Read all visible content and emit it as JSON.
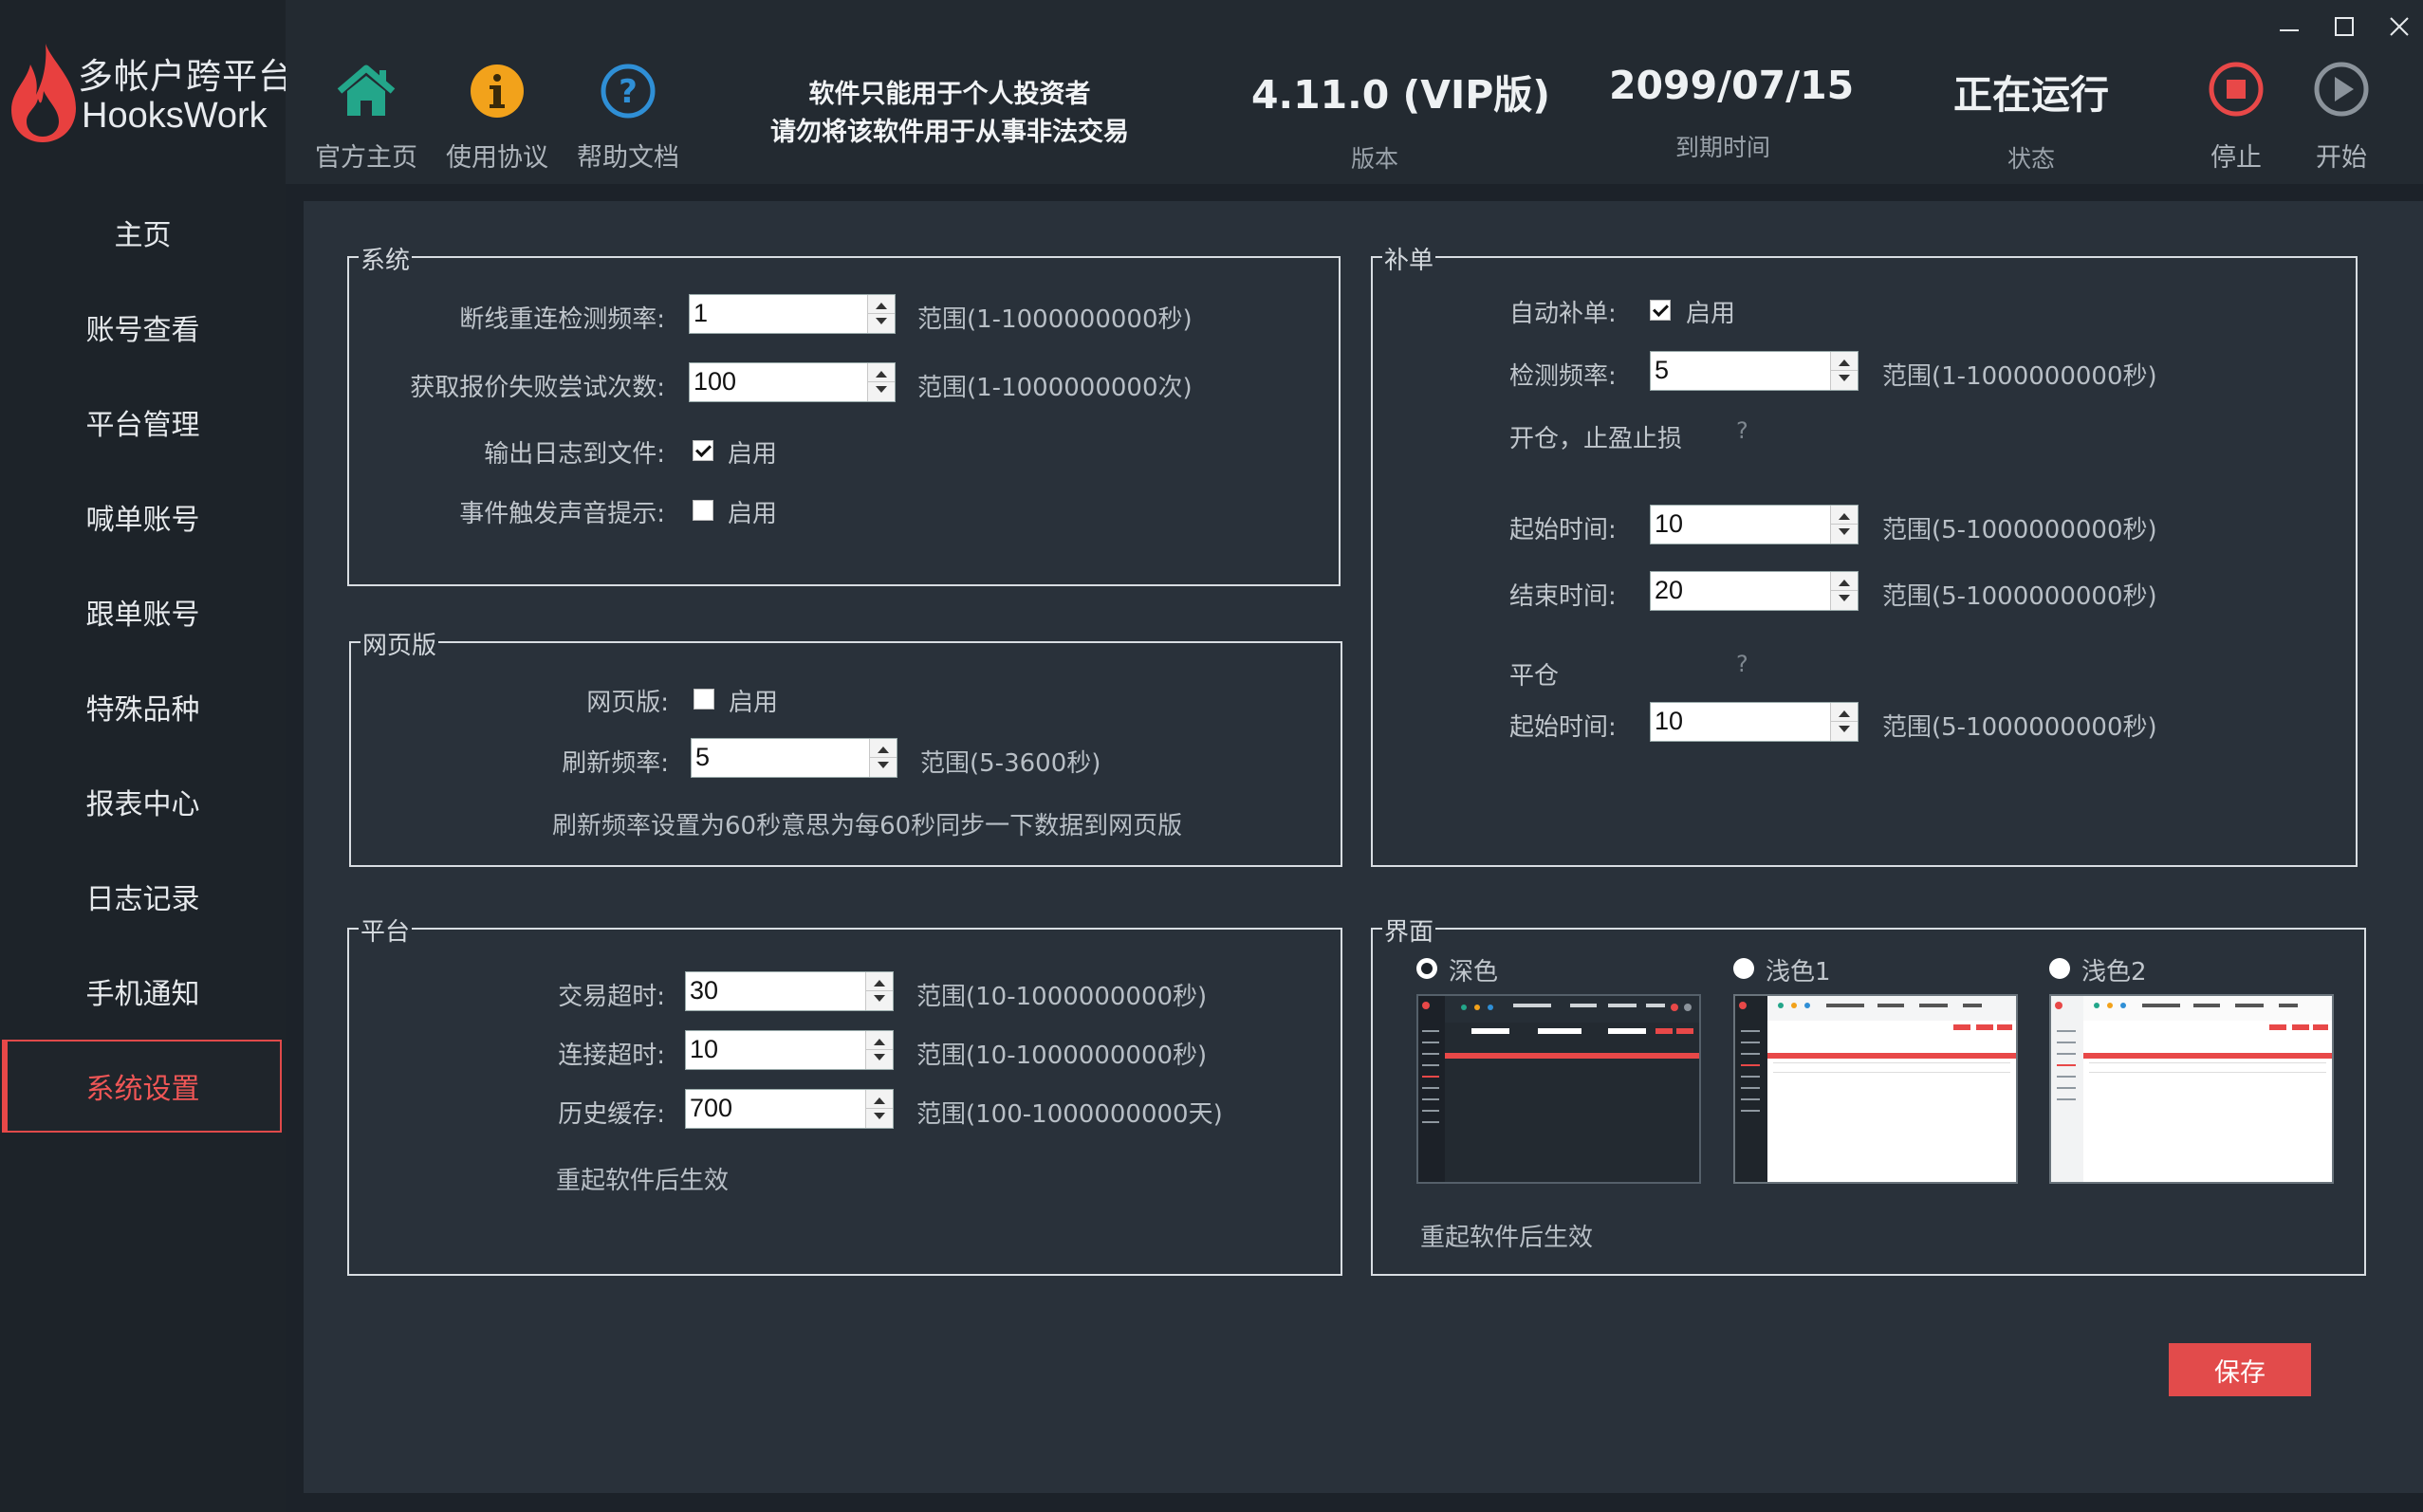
{
  "brand": {
    "title_cn": "多帐户跨平台",
    "title_en": "HooksWork"
  },
  "header": {
    "buttons": [
      {
        "label": "官方主页",
        "icon": "home-icon"
      },
      {
        "label": "使用协议",
        "icon": "info-icon"
      },
      {
        "label": "帮助文档",
        "icon": "help-icon"
      }
    ],
    "notice_line1": "软件只能用于个人投资者",
    "notice_line2": "请勿将该软件用于从事非法交易",
    "version_value": "4.11.0 (VIP版)",
    "version_label": "版本",
    "expire_value": "2099/07/15",
    "expire_label": "到期时间",
    "status_value": "正在运行",
    "status_label": "状态",
    "stop_label": "停止",
    "start_label": "开始"
  },
  "sidebar": {
    "items": [
      "主页",
      "账号查看",
      "平台管理",
      "喊单账号",
      "跟单账号",
      "特殊品种",
      "报表中心",
      "日志记录",
      "手机通知",
      "系统设置"
    ],
    "active_index": 9
  },
  "system": {
    "title": "系统",
    "reconnect_label": "断线重连检测频率:",
    "reconnect_value": "1",
    "reconnect_range": "范围(1-1000000000秒)",
    "quote_retry_label": "获取报价失败尝试次数:",
    "quote_retry_value": "100",
    "quote_retry_range": "范围(1-1000000000次)",
    "log_file_label": "输出日志到文件:",
    "log_file_enabled": true,
    "sound_label": "事件触发声音提示:",
    "sound_enabled": false,
    "enable_text": "启用"
  },
  "web": {
    "title": "网页版",
    "web_label": "网页版:",
    "web_enabled": false,
    "enable_text": "启用",
    "refresh_label": "刷新频率:",
    "refresh_value": "5",
    "refresh_range": "范围(5-3600秒)",
    "note": "刷新频率设置为60秒意思为每60秒同步一下数据到网页版"
  },
  "platform": {
    "title": "平台",
    "trade_timeout_label": "交易超时:",
    "trade_timeout_value": "30",
    "trade_timeout_range": "范围(10-1000000000秒)",
    "connect_timeout_label": "连接超时:",
    "connect_timeout_value": "10",
    "connect_timeout_range": "范围(10-1000000000秒)",
    "history_cache_label": "历史缓存:",
    "history_cache_value": "700",
    "history_cache_range": "范围(100-1000000000天)",
    "note": "重起软件后生效"
  },
  "resupply": {
    "title": "补单",
    "auto_label": "自动补单:",
    "auto_enabled": true,
    "enable_text": "启用",
    "detect_label": "检测频率:",
    "detect_value": "5",
    "detect_range": "范围(1-1000000000秒)",
    "open_section": "开仓，止盈止损",
    "help_mark": "?",
    "open_start_label": "起始时间:",
    "open_start_value": "10",
    "open_start_range": "范围(5-1000000000秒)",
    "open_end_label": "结束时间:",
    "open_end_value": "20",
    "open_end_range": "范围(5-1000000000秒)",
    "close_section": "平仓",
    "close_start_label": "起始时间:",
    "close_start_value": "10",
    "close_start_range": "范围(5-1000000000秒)"
  },
  "theme": {
    "title": "界面",
    "options": [
      "深色",
      "浅色1",
      "浅色2"
    ],
    "selected_index": 0,
    "note": "重起软件后生效"
  },
  "save_label": "保存",
  "colors": {
    "accent": "#e24b4b",
    "background": "#1c2229",
    "panel": "#29313a",
    "header": "#232a31"
  }
}
